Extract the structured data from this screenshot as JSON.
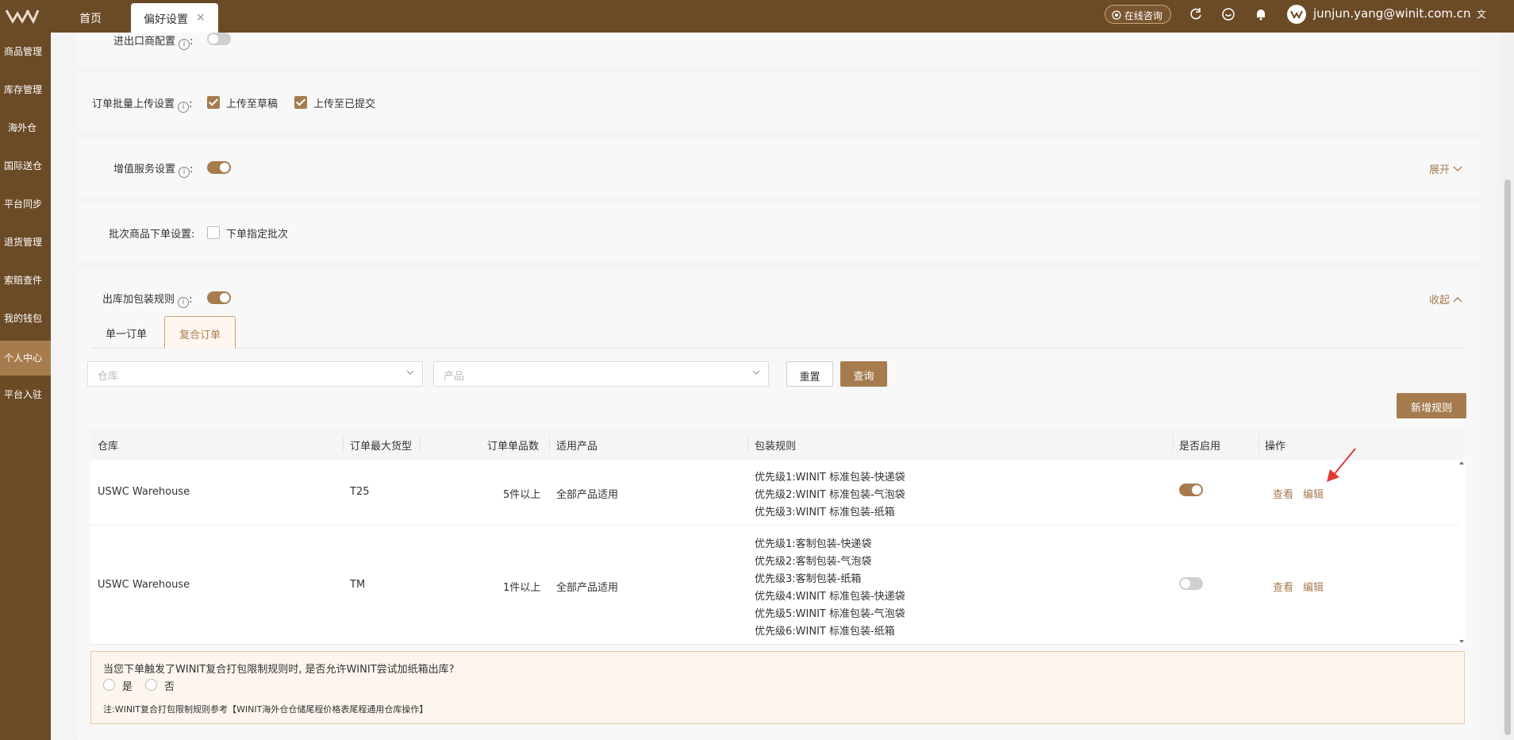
{
  "header": {
    "tabs": [
      {
        "label": "首页"
      },
      {
        "label": "偏好设置",
        "close": "×"
      }
    ],
    "online_btn": "在线咨询",
    "user_email": "junjun.yang@winit.com.cn",
    "icons": [
      "refresh-icon",
      "feedback-icon",
      "bell-icon",
      "translate-icon"
    ]
  },
  "sidebar": {
    "items": [
      {
        "label": "商品管理"
      },
      {
        "label": "库存管理"
      },
      {
        "label": "海外仓"
      },
      {
        "label": "国际送仓"
      },
      {
        "label": "平台同步"
      },
      {
        "label": "退货管理"
      },
      {
        "label": "索赔查件"
      },
      {
        "label": "我的钱包"
      },
      {
        "label": "个人中心",
        "active": true
      },
      {
        "label": "平台入驻"
      }
    ]
  },
  "settings": {
    "importer": {
      "label": "进出口商配置",
      "info": "i",
      "sep": ":",
      "enabled": false
    },
    "batch_upload": {
      "label": "订单批量上传设置",
      "info": "i",
      "sep": ":",
      "opt1": "上传至草稿",
      "opt1_checked": true,
      "opt2": "上传至已提交",
      "opt2_checked": true
    },
    "value_added": {
      "label": "增值服务设置",
      "info": "i",
      "sep": ":",
      "enabled": true,
      "expand": "展开"
    },
    "batch_goods": {
      "label": "批次商品下单设置:",
      "opt": "下单指定批次",
      "checked": false
    },
    "packaging": {
      "label": "出库加包装规则",
      "info": "i",
      "sep": ":",
      "enabled": true,
      "collapse": "收起"
    }
  },
  "subtabs": [
    {
      "label": "单一订单",
      "active": false
    },
    {
      "label": "复合订单",
      "active": true
    }
  ],
  "filters": {
    "warehouse_placeholder": "仓库",
    "product_placeholder": "产品",
    "reset": "重置",
    "query": "查询",
    "add_rule": "新增规则"
  },
  "table": {
    "headers": [
      "仓库",
      "订单最大货型",
      "订单单品数",
      "适用产品",
      "包装规则",
      "是否启用",
      "操作"
    ],
    "rows": [
      {
        "warehouse": "USWC Warehouse",
        "max_type": "T25",
        "qty": "5件以上",
        "product": "全部产品适用",
        "rules": [
          "优先级1:WINIT 标准包装-快递袋",
          "优先级2:WINIT 标准包装-气泡袋",
          "优先级3:WINIT 标准包装-纸箱"
        ],
        "enabled": true,
        "view": "查看",
        "edit": "编辑"
      },
      {
        "warehouse": "USWC Warehouse",
        "max_type": "TM",
        "qty": "1件以上",
        "product": "全部产品适用",
        "rules": [
          "优先级1:客制包装-快递袋",
          "优先级2:客制包装-气泡袋",
          "优先级3:客制包装-纸箱",
          "优先级4:WINIT 标准包装-快递袋",
          "优先级5:WINIT 标准包装-气泡袋",
          "优先级6:WINIT 标准包装-纸箱"
        ],
        "enabled": false,
        "view": "查看",
        "edit": "编辑"
      }
    ]
  },
  "notice": {
    "question": "当您下单触发了WINIT复合打包限制规则时, 是否允许WINIT尝试加纸箱出库?",
    "yes": "是",
    "no": "否",
    "note": "注:WINIT复合打包限制规则参考【WINIT海外仓仓储尾程价格表尾程通用仓库操作】"
  },
  "colors": {
    "brand": "#6b4a26",
    "accent": "#a67c4e",
    "arrow": "#e53935"
  }
}
